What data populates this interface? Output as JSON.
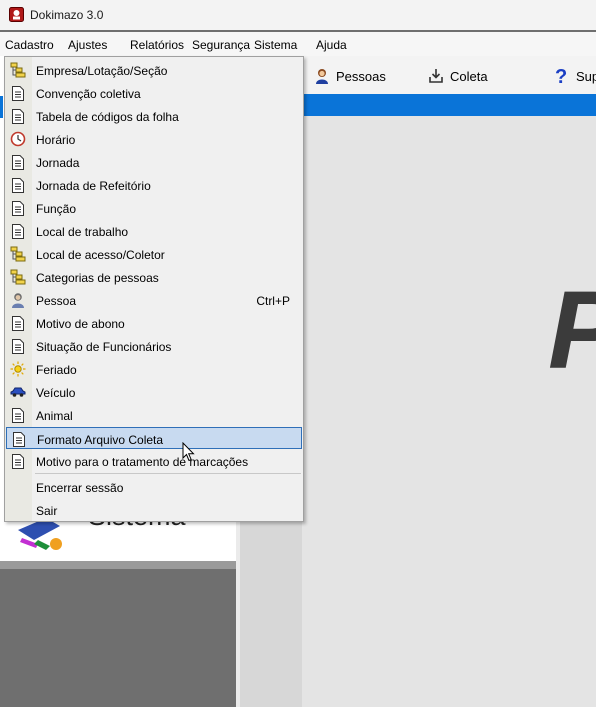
{
  "window": {
    "title": "Dokimazo 3.0"
  },
  "menubar": {
    "items": [
      {
        "id": "cadastro",
        "label": "Cadastro"
      },
      {
        "id": "ajustes",
        "label": "Ajustes"
      },
      {
        "id": "relatorios",
        "label": "Relatórios"
      },
      {
        "id": "seguranca",
        "label": "Segurança"
      },
      {
        "id": "sistema",
        "label": "Sistema"
      },
      {
        "id": "ajuda",
        "label": "Ajuda"
      }
    ]
  },
  "toolbar": {
    "pessoas": "Pessoas",
    "coleta": "Coleta",
    "suporte": "Sup"
  },
  "left_panel": {
    "sistema_text": "Sistema"
  },
  "workspace": {
    "brand_letter": "P"
  },
  "cadastro_menu": {
    "items": [
      {
        "label": "Empresa/Lotação/Seção",
        "icon": "tree-icon"
      },
      {
        "label": "Convenção coletiva",
        "icon": "document-icon"
      },
      {
        "label": "Tabela de códigos da folha",
        "icon": "document-icon"
      },
      {
        "label": "Horário",
        "icon": "clock-icon"
      },
      {
        "label": "Jornada",
        "icon": "document-icon"
      },
      {
        "label": "Jornada de Refeitório",
        "icon": "document-icon"
      },
      {
        "label": "Função",
        "icon": "document-icon"
      },
      {
        "label": "Local de trabalho",
        "icon": "document-icon"
      },
      {
        "label": "Local de acesso/Coletor",
        "icon": "tree-icon"
      },
      {
        "label": "Categorias de pessoas",
        "icon": "tree-icon"
      },
      {
        "label": "Pessoa",
        "icon": "person-icon",
        "shortcut": "Ctrl+P"
      },
      {
        "label": "Motivo de abono",
        "icon": "document-icon"
      },
      {
        "label": "Situação de Funcionários",
        "icon": "document-icon"
      },
      {
        "label": "Feriado",
        "icon": "sun-icon"
      },
      {
        "label": "Veículo",
        "icon": "car-icon"
      },
      {
        "label": "Animal",
        "icon": "document-icon"
      },
      {
        "label": "Formato Arquivo Coleta",
        "icon": "document-icon",
        "highlighted": true
      },
      {
        "label": "Motivo para o tratamento de marcações",
        "icon": "document-icon"
      },
      {
        "label": "Encerrar sessão",
        "icon": ""
      },
      {
        "label": "Sair",
        "icon": ""
      }
    ]
  },
  "colors": {
    "accent_blue": "#0a74d8",
    "highlight_bg": "#c8daf0",
    "highlight_border": "#2f6fb8"
  }
}
